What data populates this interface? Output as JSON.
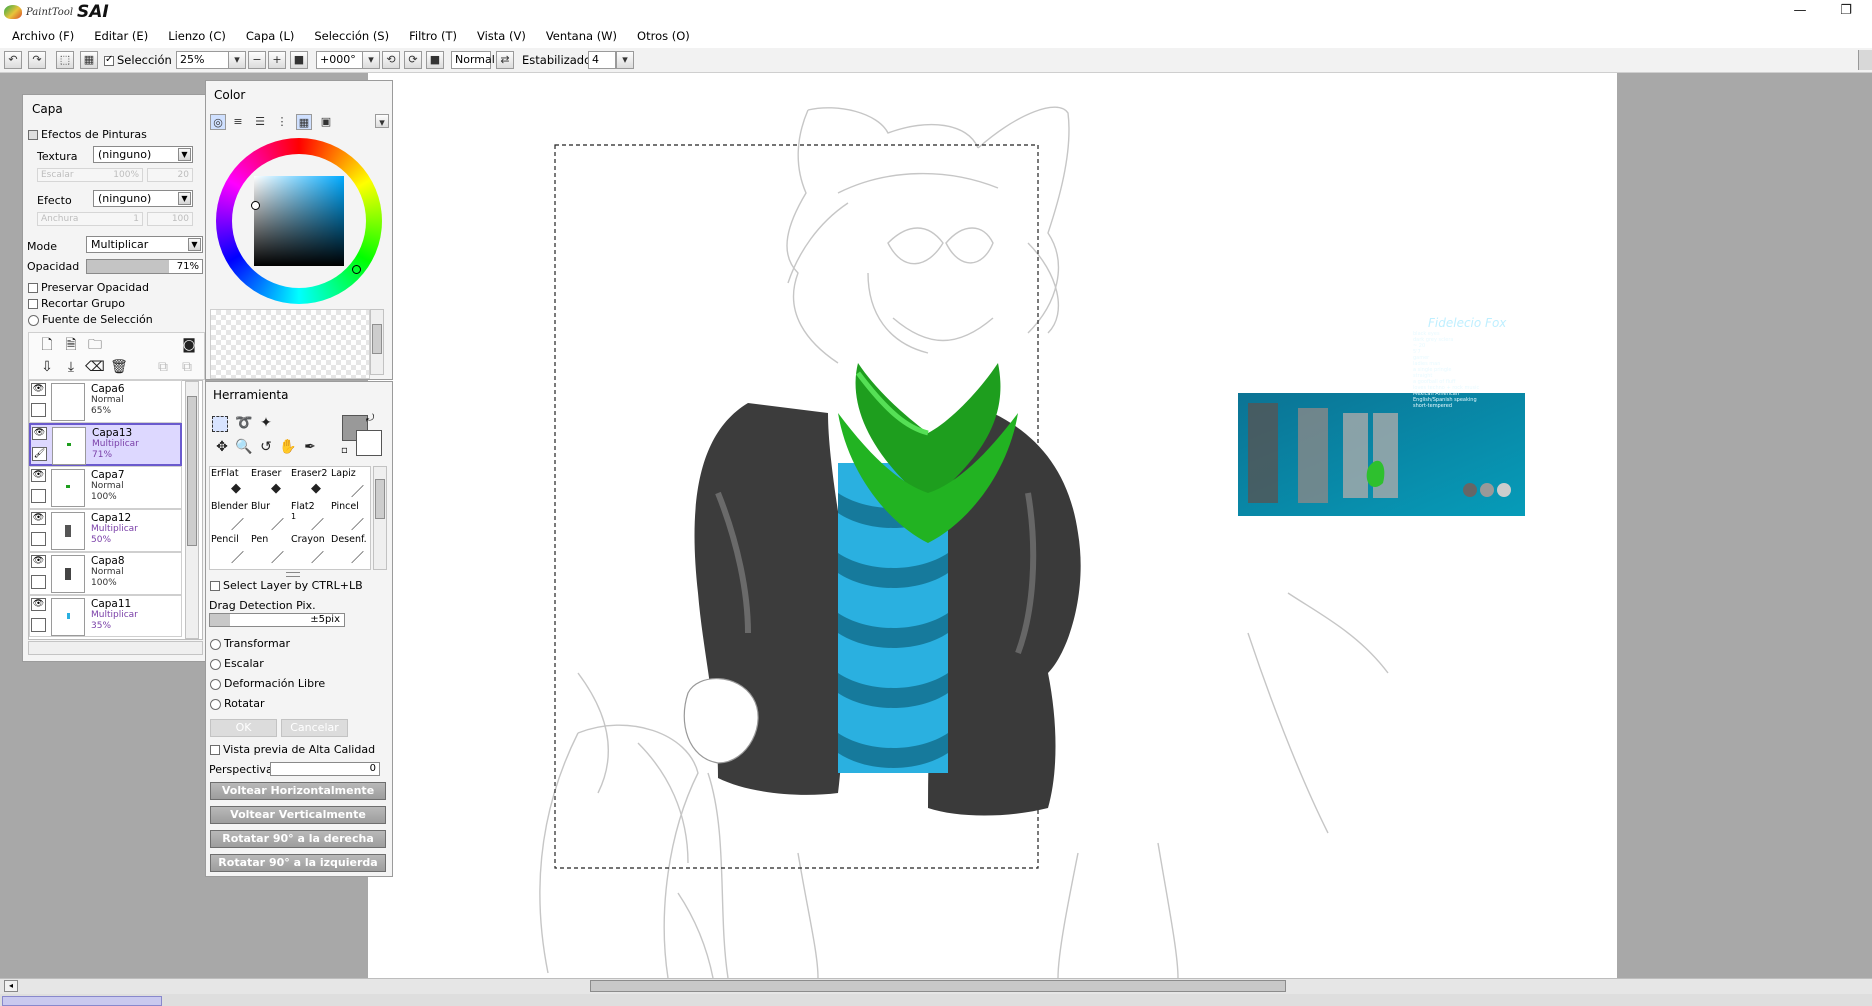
{
  "app": {
    "logo_small": "PaintTool",
    "logo_big": "SAI"
  },
  "menu": [
    "Archivo (F)",
    "Editar (E)",
    "Lienzo (C)",
    "Capa (L)",
    "Selección (S)",
    "Filtro (T)",
    "Vista (V)",
    "Ventana (W)",
    "Otros (O)"
  ],
  "toolbar": {
    "selection_label": "Selección",
    "selection_checked": true,
    "zoom": "25%",
    "rotation": "+000°",
    "blend": "Normal",
    "stabilizer_label": "Estabilizador",
    "stabilizer_value": "4"
  },
  "layer_panel": {
    "title": "Capa",
    "effects_header": "Efectos de Pinturas",
    "texture_label": "Textura",
    "texture_value": "(ninguno)",
    "scale_label": "Escalar",
    "scale_value": "100%",
    "scale_amount": "20",
    "effect_label": "Efecto",
    "effect_value": "(ninguno)",
    "width_label": "Anchura",
    "width_value": "1",
    "width_amount": "100",
    "mode_label": "Mode",
    "mode_value": "Multiplicar",
    "opacity_label": "Opacidad",
    "opacity_value": "71%",
    "opacity_fraction": 0.71,
    "preserve_opacity": "Preservar Opacidad",
    "clip_group": "Recortar Grupo",
    "selection_source": "Fuente de Selección",
    "layers": [
      {
        "name": "Capa6",
        "mode": "Normal",
        "opacity": "65%"
      },
      {
        "name": "Capa13",
        "mode": "Multiplicar",
        "opacity": "71%"
      },
      {
        "name": "Capa7",
        "mode": "Normal",
        "opacity": "100%"
      },
      {
        "name": "Capa12",
        "mode": "Multiplicar",
        "opacity": "50%"
      },
      {
        "name": "Capa8",
        "mode": "Normal",
        "opacity": "100%"
      },
      {
        "name": "Capa11",
        "mode": "Multiplicar",
        "opacity": "35%"
      }
    ]
  },
  "color_panel": {
    "title": "Color"
  },
  "tool_panel": {
    "title": "Herramienta",
    "brushes": [
      "ErFlat",
      "Eraser",
      "Eraser2",
      "Lapiz",
      "Blender",
      "Blur",
      "Flat2",
      "Pincel",
      "Pencil",
      "Pen",
      "Crayon",
      "Desenf."
    ],
    "flat2_size": "1",
    "select_layer_ctrl": "Select Layer by CTRL+LB",
    "drag_detection_label": "Drag Detection Pix.",
    "drag_detection_value": "±5pix",
    "transform_options": [
      "Transformar",
      "Escalar",
      "Deformación Libre",
      "Rotatar"
    ],
    "ok": "OK",
    "cancel": "Cancelar",
    "hq_preview": "Vista previa de Alta Calidad",
    "perspective_label": "Perspectiva",
    "perspective_value": "0",
    "flip_h": "Voltear Horizontalmente",
    "flip_v": "Voltear Verticalmente",
    "rotate_right": "Rotatar 90° a la derecha",
    "rotate_left": "Rotatar 90° a la izquierda"
  },
  "reference_sheet": {
    "title": "Fidelecio Fox",
    "notes": [
      "black eyes",
      "dark grey sclera",
      "~ 20",
      "5'7",
      "gamer",
      "ladies man",
      "a single pringle",
      "straight",
      "a goofball of fluff",
      "loves techno + rock music",
      "Mexican American",
      "English/Spanish speaking",
      "short-tempered"
    ]
  },
  "colors": {
    "workspace": "#a8a8a8",
    "jacket": "#3c3c3c",
    "scarf": "#1e9e1e",
    "shirt": "#2ab0e0",
    "selection_purple": "#6a5acd"
  }
}
